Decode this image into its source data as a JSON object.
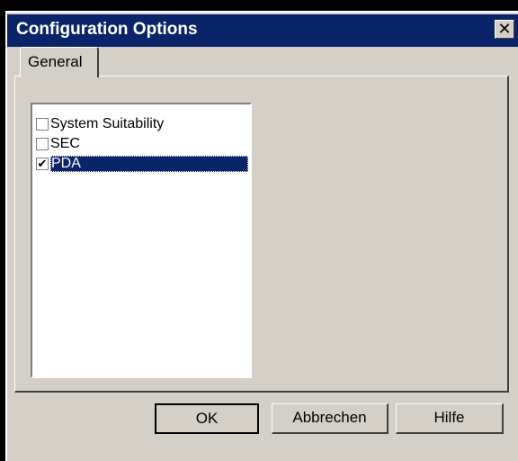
{
  "window": {
    "title": "Configuration Options",
    "close_glyph": "✕"
  },
  "tabs": [
    {
      "label": "General",
      "selected": true
    }
  ],
  "options": [
    {
      "label": "System Suitability",
      "checked": false,
      "selected": false
    },
    {
      "label": "SEC",
      "checked": false,
      "selected": false
    },
    {
      "label": "PDA",
      "checked": true,
      "selected": true
    }
  ],
  "buttons": {
    "ok": "OK",
    "cancel": "Abbrechen",
    "help": "Hilfe"
  },
  "colors": {
    "titlebar": "#0a246a",
    "selection": "#0a246a",
    "face": "#d4d0c8"
  }
}
